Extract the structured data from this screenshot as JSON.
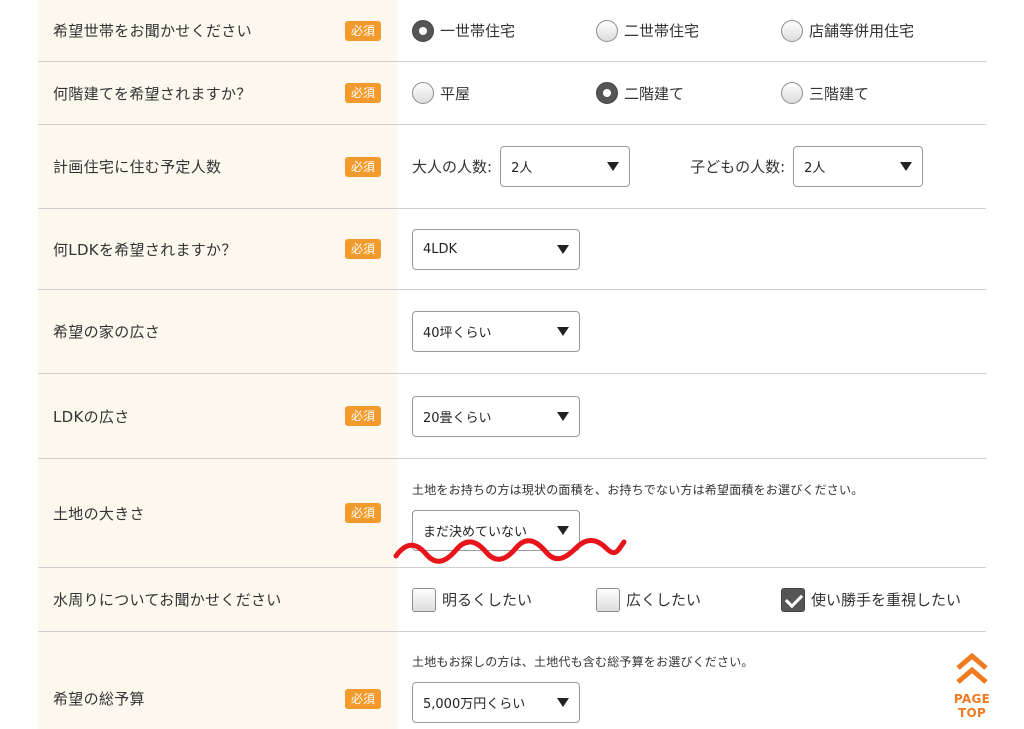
{
  "required_label": "必須",
  "rows": {
    "household": {
      "label": "希望世帯をお聞かせください",
      "options": [
        "一世帯住宅",
        "二世帯住宅",
        "店舗等併用住宅"
      ]
    },
    "floors": {
      "label": "何階建てを希望されますか？",
      "options": [
        "平屋",
        "二階建て",
        "三階建て"
      ]
    },
    "people": {
      "label": "計画住宅に住む予定人数",
      "adults_label": "大人の人数:",
      "adults_value": "2人",
      "children_label": "子どもの人数:",
      "children_value": "2人"
    },
    "ldk_type": {
      "label": "何LDKを希望されますか？",
      "value": "4LDK"
    },
    "house_size": {
      "label": "希望の家の広さ",
      "value": "40坪くらい"
    },
    "ldk_size": {
      "label": "LDKの広さ",
      "value": "20畳くらい"
    },
    "land_size": {
      "label": "土地の大きさ",
      "note": "土地をお持ちの方は現状の面積を、お持ちでない方は希望面積をお選びください。",
      "value": "まだ決めていない"
    },
    "water": {
      "label": "水周りについてお聞かせください",
      "options": [
        "明るくしたい",
        "広くしたい",
        "使い勝手を重視したい"
      ]
    },
    "budget": {
      "label": "希望の総予算",
      "note": "土地もお探しの方は、土地代も含む総予算をお選びください。",
      "value": "5,000万円くらい"
    }
  },
  "selected": {
    "household": "一世帯住宅",
    "floors": "二階建て",
    "water_checked": [
      "使い勝手を重視したい"
    ]
  },
  "page_top": {
    "label": "PAGE TOP"
  },
  "colors": {
    "accent": "#f39a2c",
    "label_bg": "#fdf8ee",
    "page_top": "#f07a22",
    "annotation": "#e8141b"
  }
}
